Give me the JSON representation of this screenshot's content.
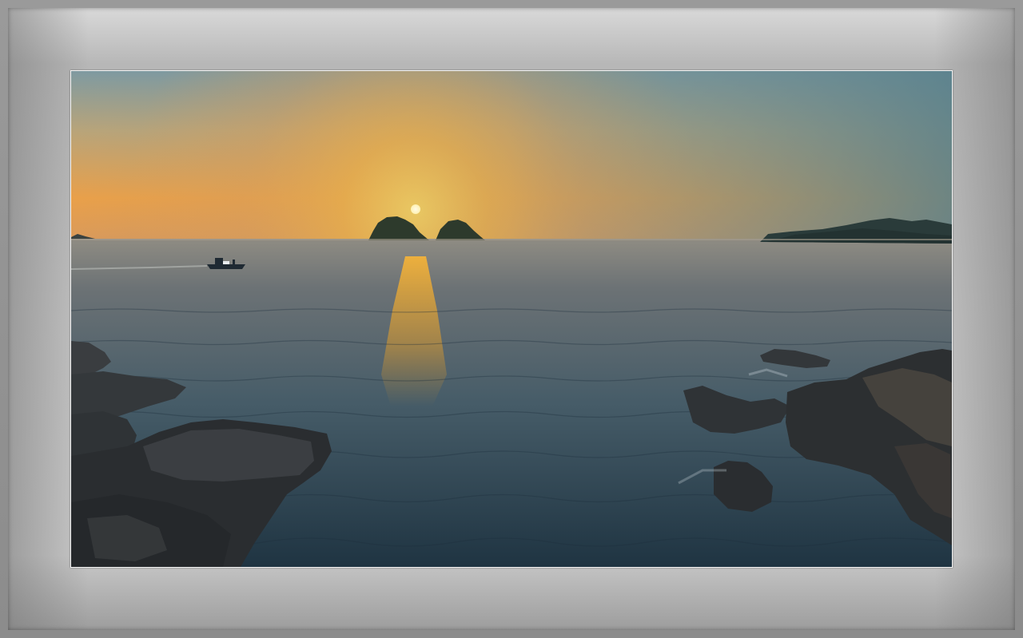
{
  "scene": {
    "subject": "sunset-over-sea",
    "colors": {
      "sky_top": "#6f8e9a",
      "sky_glow": "#f3a53a",
      "sun": "#fff6c8",
      "sea": "#3d5666",
      "rock": "#2e3134",
      "mat": "#c4c4c4"
    }
  }
}
